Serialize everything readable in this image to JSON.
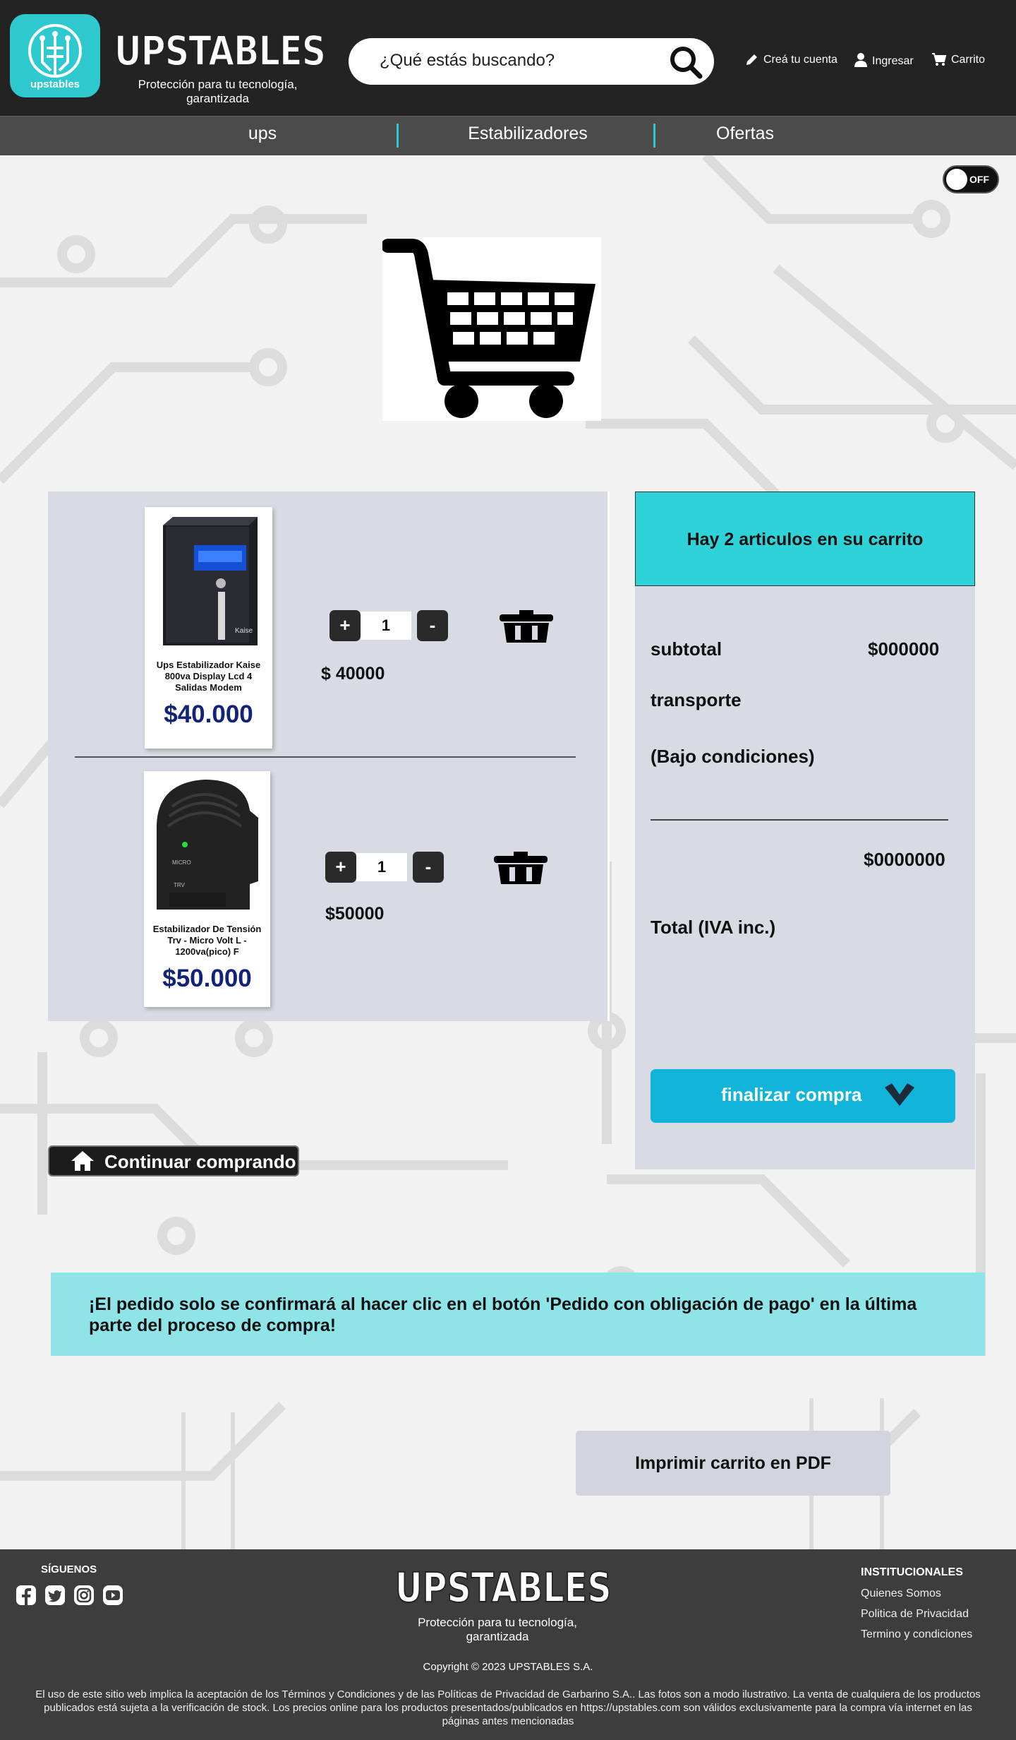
{
  "header": {
    "logo_word": "upstables",
    "brand": "UPSTABLES",
    "tagline": "Protección para tu tecnología, garantizada",
    "search_placeholder": "¿Qué estás buscando?",
    "links": {
      "register": "Creá tu cuenta",
      "login": "Ingresar",
      "cart": "Carrito"
    }
  },
  "nav": {
    "items": [
      "ups",
      "Estabilizadores",
      "Ofertas"
    ]
  },
  "toggle": {
    "label": "OFF"
  },
  "cart": {
    "items": [
      {
        "name": "Ups Estabilizador Kaise 800va Display Lcd 4 Salidas Modem",
        "price": "$40.000",
        "qty": "1",
        "line_total": "$ 40000"
      },
      {
        "name": "Estabilizador De Tensión Trv - Micro Volt L - 1200va(pico) F",
        "price": "$50.000",
        "qty": "1",
        "line_total": "$50000"
      }
    ],
    "plus": "+",
    "minus": "-"
  },
  "summary": {
    "header": "Hay 2 articulos en su carrito",
    "subtotal_label": "subtotal",
    "subtotal_value": "$000000",
    "shipping_label": "transporte",
    "conditions": "(Bajo condiciones)",
    "total_value": "$0000000",
    "total_label": "Total (IVA inc.)",
    "checkout": "finalizar compra"
  },
  "continue_label": "Continuar comprando",
  "notice": "¡El pedido solo se confirmará al hacer clic en el botón 'Pedido con obligación de pago' en la última parte del proceso de compra!",
  "print_label": "Imprimir carrito en PDF",
  "footer": {
    "follow": "SÍGUENOS",
    "brand": "UPSTABLES",
    "tagline": "Protección para tu tecnología, garantizada",
    "inst_header": "INSTITUCIONALES",
    "inst_links": [
      "Quienes Somos",
      "Politica de Privacidad",
      "Termino y condiciones"
    ],
    "copyright": "Copyright © 2023 UPSTABLES S.A.",
    "legal": "El uso de este sitio web implica la aceptación de los Términos y Condiciones y de las Políticas de Privacidad de Garbarino S.A.. Las fotos son a modo ilustrativo. La venta de cualquiera de los productos publicados está sujeta a la verificación de stock. Los precios online para los productos presentados/publicados en https://upstables.com  son válidos exclusivamente para la compra vía internet en las páginas antes mencionadas"
  },
  "colors": {
    "accent": "#2ec9cf",
    "header_bg": "#232323",
    "nav_bg": "#4b4b4b",
    "price": "#13237a",
    "checkout": "#12b5d9",
    "notice": "#8ee4e6",
    "panel": "#d9dbe4"
  }
}
